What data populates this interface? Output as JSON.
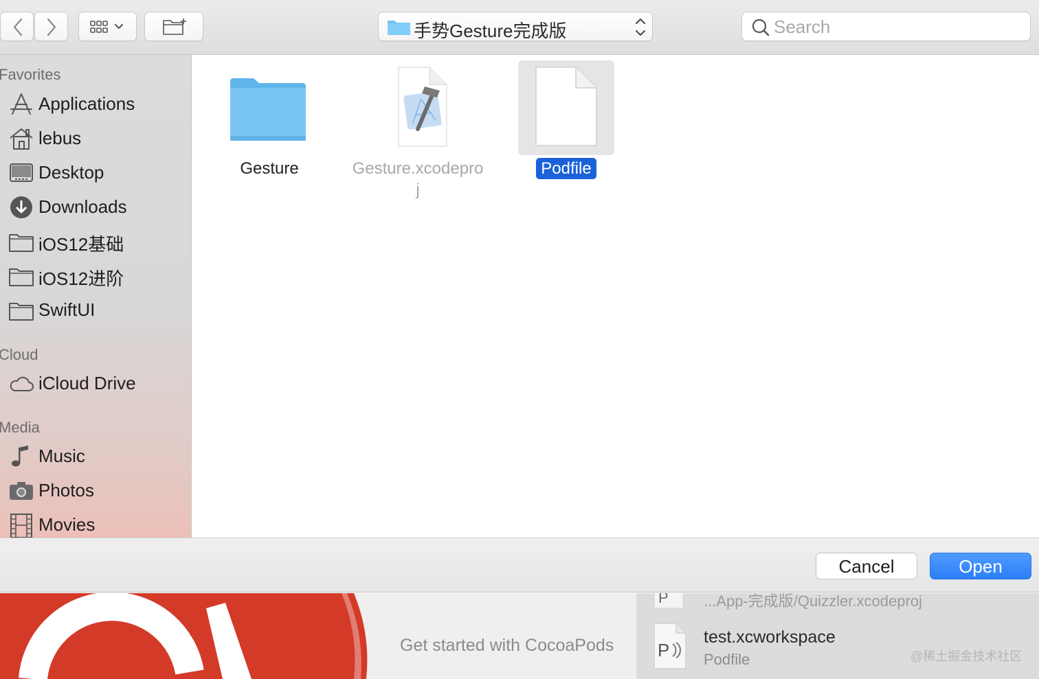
{
  "toolbar": {
    "back_icon": "chevron-left-icon",
    "forward_icon": "chevron-right-icon",
    "view_icon": "grid-view-icon",
    "new_folder_icon": "new-folder-icon",
    "path_label": "手势Gesture完成版",
    "search_placeholder": "Search"
  },
  "sidebar": {
    "sections": [
      {
        "heading": "Favorites",
        "items": [
          {
            "label": "Applications",
            "icon": "applications-icon"
          },
          {
            "label": "lebus",
            "icon": "home-icon"
          },
          {
            "label": "Desktop",
            "icon": "desktop-icon"
          },
          {
            "label": "Downloads",
            "icon": "downloads-icon"
          },
          {
            "label": "iOS12基础",
            "icon": "folder-icon"
          },
          {
            "label": "iOS12进阶",
            "icon": "folder-icon"
          },
          {
            "label": "SwiftUI",
            "icon": "folder-icon"
          }
        ]
      },
      {
        "heading": "Cloud",
        "items": [
          {
            "label": "iCloud Drive",
            "icon": "cloud-icon"
          }
        ]
      },
      {
        "heading": "Media",
        "items": [
          {
            "label": "Music",
            "icon": "music-icon"
          },
          {
            "label": "Photos",
            "icon": "camera-icon"
          },
          {
            "label": "Movies",
            "icon": "film-icon"
          }
        ]
      }
    ]
  },
  "files": [
    {
      "name": "Gesture",
      "icon": "folder-icon",
      "dimmed": false,
      "selected": false
    },
    {
      "name": "Gesture.xcodeproj",
      "icon": "xcode-project-icon",
      "dimmed": true,
      "selected": false
    },
    {
      "name": "Podfile",
      "icon": "document-icon",
      "dimmed": false,
      "selected": true
    }
  ],
  "buttons": {
    "cancel": "Cancel",
    "open": "Open"
  },
  "background": {
    "get_started": "Get started with CocoaPods",
    "recent_partial": "...App-完成版/Quizzler.xcodeproj",
    "recent_name": "test.xcworkspace",
    "recent_sub": "Podfile",
    "watermark": "@稀土掘金技术社区"
  },
  "colors": {
    "accent": "#2c7ef8",
    "selection": "#1b62d8",
    "folder": "#6fc3f4",
    "cocoapods_red": "#d33a28"
  }
}
